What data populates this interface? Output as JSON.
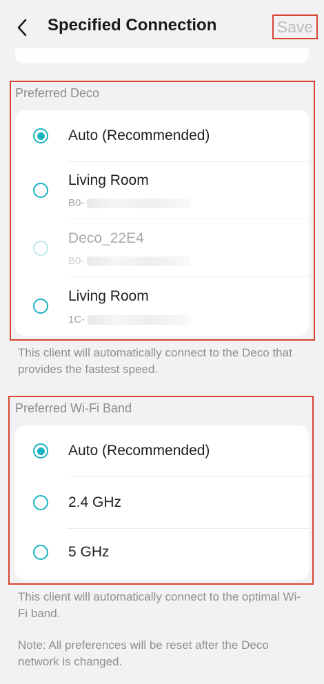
{
  "header": {
    "title": "Specified Connection",
    "save_label": "Save"
  },
  "preferred_deco": {
    "label": "Preferred Deco",
    "options": [
      {
        "label": "Auto (Recommended)",
        "sub": "",
        "selected": true,
        "enabled": true
      },
      {
        "label": "Living Room",
        "sub": "B0-",
        "selected": false,
        "enabled": true
      },
      {
        "label": "Deco_22E4",
        "sub": "B0-",
        "selected": false,
        "enabled": false
      },
      {
        "label": "Living Room",
        "sub": "1C-",
        "selected": false,
        "enabled": true
      }
    ],
    "note": "This client will automatically connect to the Deco that provides the fastest speed."
  },
  "preferred_band": {
    "label": "Preferred Wi-Fi Band",
    "options": [
      {
        "label": "Auto (Recommended)",
        "selected": true
      },
      {
        "label": "2.4 GHz",
        "selected": false
      },
      {
        "label": "5 GHz",
        "selected": false
      }
    ],
    "note": "This client will automatically connect to the optimal Wi-Fi band."
  },
  "footer_note": "Note: All preferences will be reset after the Deco network is changed.",
  "colors": {
    "accent": "#19b3c2",
    "highlight_border": "#d8442f",
    "background": "#f2f2f4"
  }
}
